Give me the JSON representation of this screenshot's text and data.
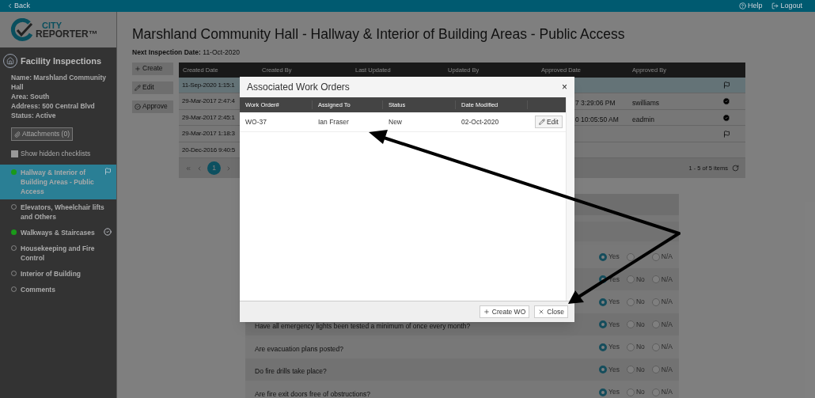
{
  "top_bar": {
    "back": "Back",
    "help": "Help",
    "logout": "Logout"
  },
  "logo": {
    "line1": "CITY",
    "line2": "REPORTER™"
  },
  "sidebar": {
    "heading": "Facility Inspections",
    "details": [
      "Name: Marshland Community Hall",
      "Area: South",
      "Address: 500 Central Blvd",
      "Status: Active"
    ],
    "attachments_button": "Attachments (0)",
    "show_hidden": {
      "label": "Show hidden checklists",
      "checked": false
    },
    "checklists": [
      {
        "label": "Hallway & Interior of Building Areas - Public Access",
        "selected": true,
        "started": true,
        "flagged": true,
        "completed": false
      },
      {
        "label": "Elevators, Wheelchair lifts and Others",
        "selected": false,
        "started": false
      },
      {
        "label": "Walkways & Staircases",
        "selected": false,
        "started": true,
        "flagged": false,
        "completed": true
      },
      {
        "label": "Housekeeping and Fire Control",
        "selected": false,
        "started": false
      },
      {
        "label": "Interior of Building",
        "selected": false,
        "started": false
      },
      {
        "label": "Comments",
        "selected": false,
        "started": false
      }
    ]
  },
  "main": {
    "title": "Marshland Community Hall - Hallway & Interior of Building Areas - Public Access",
    "next_inspection": {
      "label": "Next Inspection Date:",
      "value": "11-Oct-2020"
    },
    "actions": [
      "Create",
      "Edit",
      "Approve"
    ],
    "inspections_table": {
      "columns": [
        "Created Date",
        "Created By",
        "Last Updated",
        "Updated By",
        "Approved Date",
        "Approved By"
      ],
      "rows": [
        {
          "created_date": "11-Sep-2020 1:15:1",
          "selected": true,
          "flagged": true,
          "approved": false
        },
        {
          "created_date": "29-Mar-2017 2:47:4",
          "approved_date": "7 3:29:06 PM",
          "approved_by": "swilliams",
          "selected": false,
          "flagged": false,
          "approved": true
        },
        {
          "created_date": "29-Mar-2017 2:45:1",
          "approved_date": "0 10:05:50 AM",
          "approved_by": "eadmin",
          "selected": false,
          "flagged": false,
          "approved": true
        },
        {
          "created_date": "29-Mar-2017 1:18:3",
          "selected": false,
          "flagged": true,
          "approved": false
        },
        {
          "created_date": "20-Dec-2016 9:40:5",
          "selected": false,
          "flagged": false,
          "approved": false
        }
      ],
      "pagination": {
        "page": "1",
        "summary": "1 - 5 of 5 items"
      }
    },
    "checklist": {
      "rows": [
        {
          "options": [
            {
              "label": "Yes",
              "selected": true
            },
            {
              "selected": false
            },
            {
              "label": "N/A",
              "selected": false
            }
          ]
        },
        {
          "options": [
            {
              "label": "Yes",
              "selected": true
            },
            {
              "label": "No",
              "selected": false
            },
            {
              "label": "N/A",
              "selected": false
            }
          ]
        },
        {
          "options": [
            {
              "label": "Yes",
              "selected": true
            },
            {
              "label": "No",
              "selected": false
            },
            {
              "label": "N/A",
              "selected": false
            }
          ]
        },
        {
          "question": "Have all emergency lights been tested a minimum of once every month?",
          "options": [
            {
              "label": "Yes",
              "selected": true
            },
            {
              "label": "No",
              "selected": false
            },
            {
              "label": "N/A",
              "selected": false
            }
          ]
        },
        {
          "question": "Are evacuation plans posted?",
          "options": [
            {
              "label": "Yes",
              "selected": true
            },
            {
              "label": "No",
              "selected": false
            },
            {
              "label": "N/A",
              "selected": false
            }
          ]
        },
        {
          "question": "Do fire drills take place?",
          "options": [
            {
              "label": "Yes",
              "selected": true
            },
            {
              "label": "No",
              "selected": false
            },
            {
              "label": "N/A",
              "selected": false
            }
          ]
        },
        {
          "question": "Are fire exit doors free of obstructions?",
          "options": [
            {
              "label": "Yes",
              "selected": true
            },
            {
              "label": "No",
              "selected": false
            },
            {
              "label": "N/A",
              "selected": false
            }
          ]
        }
      ]
    }
  },
  "modal": {
    "title": "Associated Work Orders",
    "close": "×",
    "columns": [
      "Work Order#",
      "Assigned To",
      "Status",
      "Date Modified"
    ],
    "rows": [
      {
        "work_order": "WO-37",
        "assigned_to": "Ian Fraser",
        "status": "New",
        "date_modified": "02-Oct-2020",
        "action": "Edit"
      }
    ],
    "buttons": [
      "Create WO",
      "Close"
    ]
  }
}
